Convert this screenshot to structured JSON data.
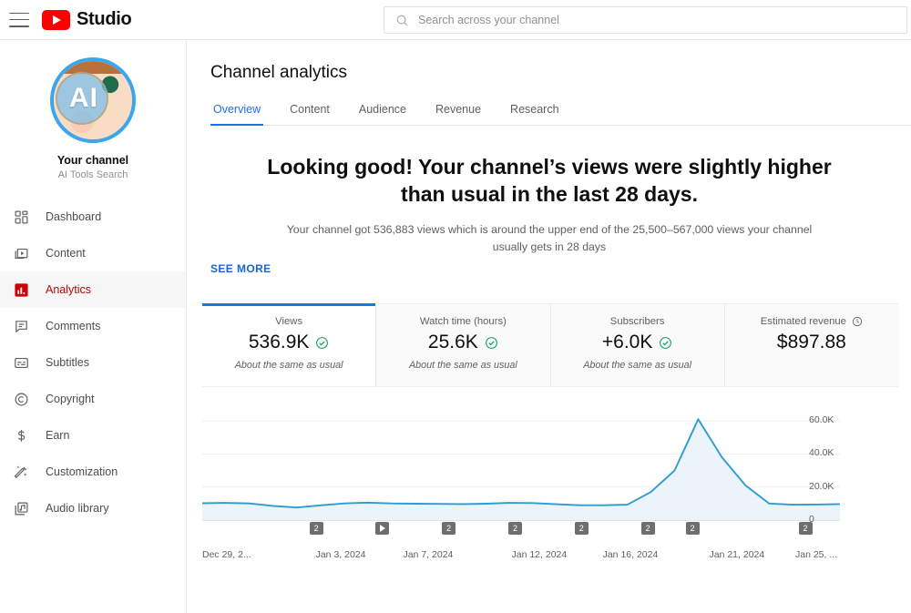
{
  "topbar": {
    "menu_icon": "hamburger-icon",
    "logo_icon": "youtube-logo-icon",
    "brand": "Studio",
    "search": {
      "icon": "search-icon",
      "value": "",
      "placeholder": "Search across your channel"
    }
  },
  "sidebar": {
    "avatar": {
      "icon": "channel-avatar",
      "initials": "AI"
    },
    "channel_title": "Your channel",
    "channel_name": "AI Tools Search",
    "items": [
      {
        "label": "Dashboard",
        "icon": "dashboard-icon",
        "active": false
      },
      {
        "label": "Content",
        "icon": "content-icon",
        "active": false
      },
      {
        "label": "Analytics",
        "icon": "analytics-icon",
        "active": true
      },
      {
        "label": "Comments",
        "icon": "comments-icon",
        "active": false
      },
      {
        "label": "Subtitles",
        "icon": "subtitles-icon",
        "active": false
      },
      {
        "label": "Copyright",
        "icon": "copyright-icon",
        "active": false
      },
      {
        "label": "Earn",
        "icon": "dollar-icon",
        "active": false
      },
      {
        "label": "Customization",
        "icon": "customization-icon",
        "active": false
      },
      {
        "label": "Audio library",
        "icon": "audio-library-icon",
        "active": false
      }
    ]
  },
  "main": {
    "page_title": "Channel analytics",
    "tabs": [
      {
        "label": "Overview",
        "active": true
      },
      {
        "label": "Content",
        "active": false
      },
      {
        "label": "Audience",
        "active": false
      },
      {
        "label": "Revenue",
        "active": false
      },
      {
        "label": "Research",
        "active": false
      }
    ],
    "headline": "Looking good! Your channel’s views were slightly higher than usual in the last 28 days.",
    "subline": "Your channel got 536,883 views which is around the upper end of the 25,500–567,000 views your channel usually gets in 28 days",
    "cards": [
      {
        "label": "Views",
        "value": "536.9K",
        "note": "About the same as usual",
        "status_icon": "check-circle-icon",
        "label_icon": "",
        "active": true
      },
      {
        "label": "Watch time (hours)",
        "value": "25.6K",
        "note": "About the same as usual",
        "status_icon": "check-circle-icon",
        "label_icon": "",
        "active": false
      },
      {
        "label": "Subscribers",
        "value": "+6.0K",
        "note": "About the same as usual",
        "status_icon": "check-circle-icon",
        "label_icon": "",
        "active": false
      },
      {
        "label": "Estimated revenue",
        "value": "$897.88",
        "note": "",
        "status_icon": "",
        "label_icon": "clock-icon",
        "active": false
      }
    ],
    "see_more": "SEE MORE"
  },
  "colors": {
    "accent_blue": "#1a73e8",
    "link_blue": "#1666d0",
    "brand_red": "#ff0000",
    "active_red": "#cc0000",
    "chart_line": "#2f9bd1",
    "chart_fill": "#eaf4fa",
    "check_green": "#0f9d58"
  },
  "chart_data": {
    "type": "area",
    "title": "",
    "xlabel": "",
    "ylabel": "",
    "ylim": [
      0,
      65000
    ],
    "yticks": [
      0,
      20000,
      40000,
      60000
    ],
    "ytick_labels": [
      "0",
      "20.0K",
      "40.0K",
      "60.0K"
    ],
    "grid": true,
    "legend": "none",
    "x": [
      "Dec 29",
      "Dec 30",
      "Dec 31",
      "Jan 1",
      "Jan 2",
      "Jan 3",
      "Jan 4",
      "Jan 5",
      "Jan 6",
      "Jan 7",
      "Jan 8",
      "Jan 9",
      "Jan 10",
      "Jan 11",
      "Jan 12",
      "Jan 13",
      "Jan 14",
      "Jan 15",
      "Jan 16",
      "Jan 17",
      "Jan 18",
      "Jan 19",
      "Jan 20",
      "Jan 21",
      "Jan 22",
      "Jan 23",
      "Jan 24",
      "Jan 25"
    ],
    "xtick_labels": [
      "Dec 29, 2...",
      "Jan 3, 2024",
      "Jan 7, 2024",
      "Jan 12, 2024",
      "Jan 16, 2024",
      "Jan 21, 2024",
      "Jan 25, ..."
    ],
    "series": [
      {
        "name": "Views",
        "values": [
          10200,
          10400,
          10100,
          8600,
          7600,
          8900,
          10100,
          10600,
          10100,
          9900,
          9800,
          9700,
          9900,
          10400,
          10300,
          9600,
          9000,
          9000,
          9300,
          17000,
          30000,
          61000,
          38000,
          21000,
          10000,
          9300,
          9400,
          9700
        ]
      }
    ],
    "markers": [
      {
        "x_pct": 17.8,
        "label": "2",
        "type": "video-count"
      },
      {
        "x_pct": 28.2,
        "label": "play",
        "type": "video-play"
      },
      {
        "x_pct": 38.6,
        "label": "2",
        "type": "video-count"
      },
      {
        "x_pct": 49.0,
        "label": "2",
        "type": "video-count"
      },
      {
        "x_pct": 59.4,
        "label": "2",
        "type": "video-count"
      },
      {
        "x_pct": 69.8,
        "label": "2",
        "type": "video-count"
      },
      {
        "x_pct": 76.8,
        "label": "2",
        "type": "video-count"
      },
      {
        "x_pct": 94.5,
        "label": "2",
        "type": "video-count"
      }
    ]
  }
}
